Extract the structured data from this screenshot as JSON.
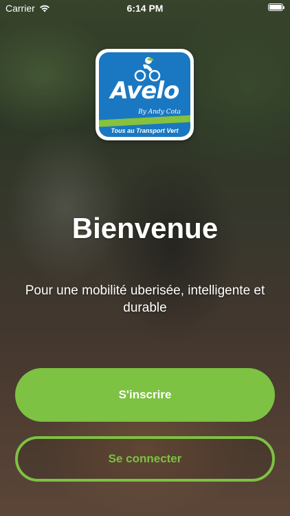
{
  "status_bar": {
    "carrier": "Carrier",
    "time": "6:14 PM",
    "wifi_icon": "wifi-icon",
    "battery_icon": "battery-icon"
  },
  "logo": {
    "name": "Avelo",
    "byline": "By Andy Cota",
    "tagline": "Tous au Transport Vert",
    "colors": {
      "primary": "#1a78c2",
      "accent": "#86c23b"
    }
  },
  "welcome": {
    "title": "Bienvenue",
    "subtitle": "Pour une mobilité uberisée, intelligente et durable"
  },
  "actions": {
    "signup_label": "S'inscrire",
    "login_label": "Se connecter",
    "accent_color": "#7dc242"
  }
}
